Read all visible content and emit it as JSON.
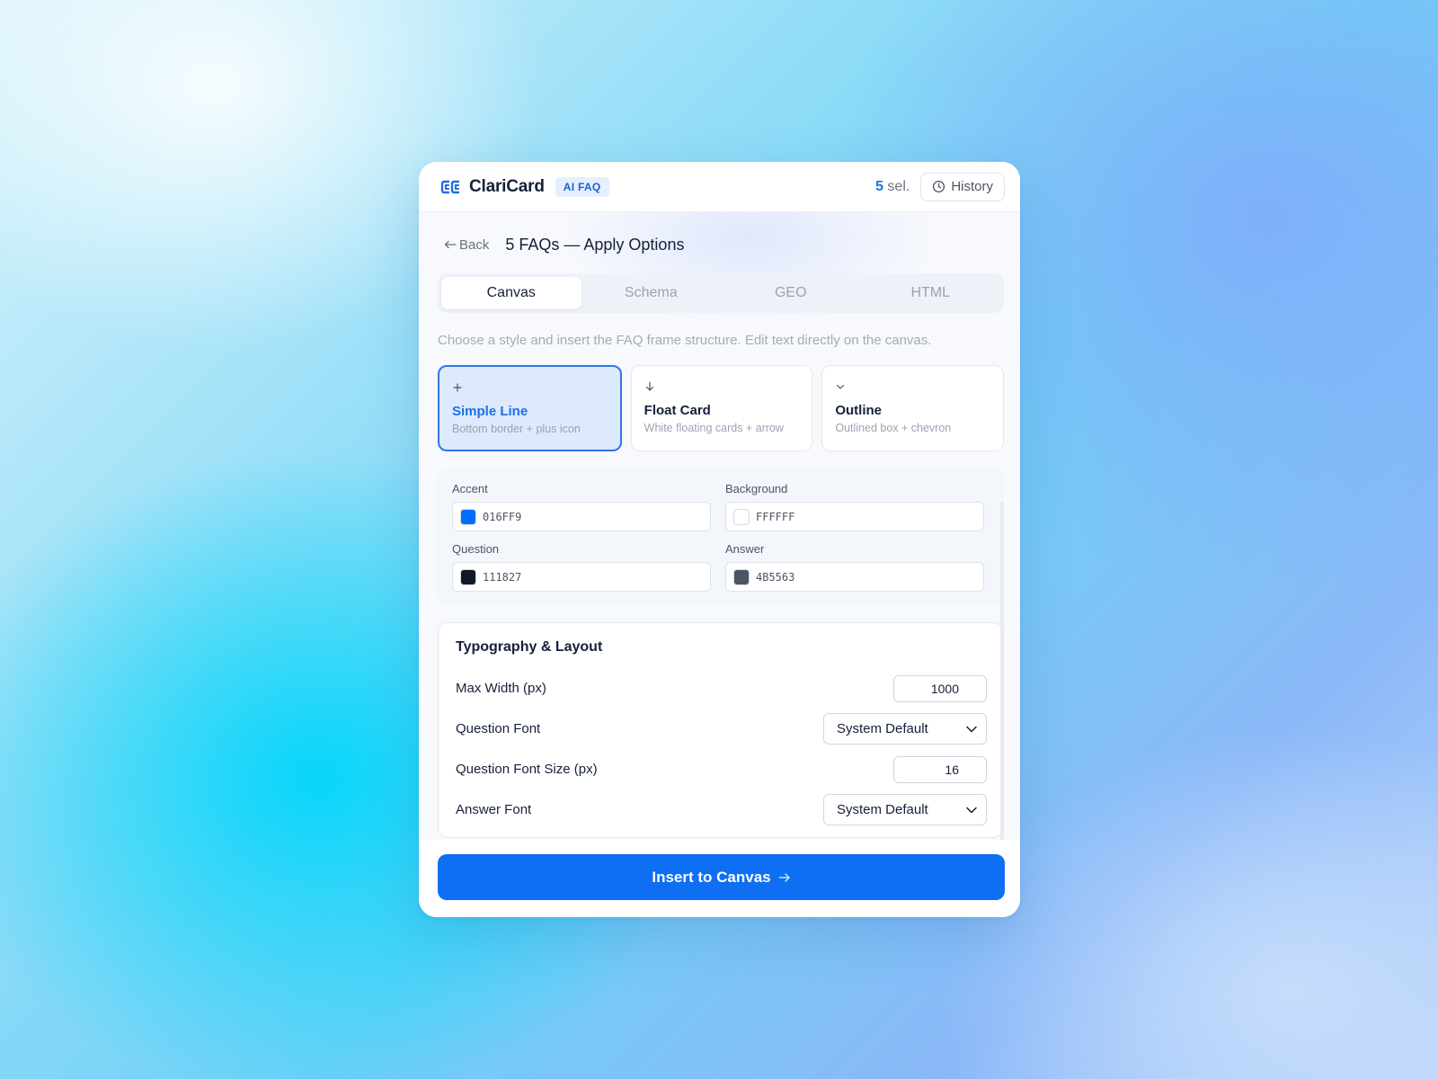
{
  "header": {
    "brand": "ClariCard",
    "badge": "AI FAQ",
    "selection_count": "5",
    "selection_suffix": "sel.",
    "history_label": "History"
  },
  "nav": {
    "back_label": "Back",
    "title": "5 FAQs — Apply Options"
  },
  "tabs": [
    {
      "label": "Canvas",
      "active": true
    },
    {
      "label": "Schema",
      "active": false
    },
    {
      "label": "GEO",
      "active": false
    },
    {
      "label": "HTML",
      "active": false
    }
  ],
  "hint": "Choose a style and insert the FAQ frame structure. Edit text directly on the canvas.",
  "styles": [
    {
      "icon": "plus-icon",
      "title": "Simple Line",
      "desc": "Bottom border + plus icon",
      "selected": true
    },
    {
      "icon": "arrow-down-icon",
      "title": "Float Card",
      "desc": "White floating cards + arrow",
      "selected": false
    },
    {
      "icon": "chevron-down-icon",
      "title": "Outline",
      "desc": "Outlined box + chevron",
      "selected": false
    }
  ],
  "colors": {
    "accent": {
      "label": "Accent",
      "value": "016FF9",
      "hex": "#016FF9"
    },
    "background": {
      "label": "Background",
      "value": "FFFFFF",
      "hex": "#FFFFFF"
    },
    "question": {
      "label": "Question",
      "value": "111827",
      "hex": "#111827"
    },
    "answer": {
      "label": "Answer",
      "value": "4B5563",
      "hex": "#4B5563"
    }
  },
  "typography": {
    "title": "Typography & Layout",
    "max_width_label": "Max Width (px)",
    "max_width_value": "1000",
    "question_font_label": "Question Font",
    "question_font_value": "System Default",
    "question_size_label": "Question Font Size (px)",
    "question_size_value": "16",
    "answer_font_label": "Answer Font",
    "answer_font_value": "System Default"
  },
  "footer": {
    "insert_label": "Insert to Canvas"
  }
}
